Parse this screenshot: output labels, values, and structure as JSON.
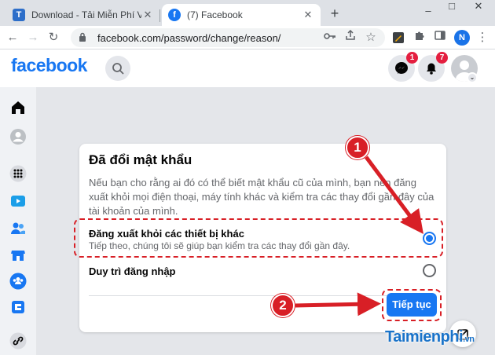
{
  "browser": {
    "tabs": [
      {
        "title": "Download - Tải Miễn Phí VN - Ph",
        "favicon": "T",
        "active": false
      },
      {
        "title": "(7) Facebook",
        "favicon": "f",
        "active": true
      }
    ],
    "new_tab": "+",
    "url": "facebook.com/password/change/reason/",
    "profile_initial": "N",
    "window_controls": [
      "–",
      "□",
      "✕"
    ]
  },
  "facebook": {
    "logo": "facebook",
    "badges": {
      "messenger": "1",
      "notifications": "7"
    },
    "accent": "#1877f2"
  },
  "card": {
    "title": "Đã đổi mật khẩu",
    "description": "Nếu bạn cho rằng ai đó có thể biết mật khẩu cũ của mình, bạn nên đăng xuất khỏi mọi điện thoại, máy tính khác và kiểm tra các thay đổi gần đây của tài khoản của mình.",
    "options": [
      {
        "label": "Đăng xuất khỏi các thiết bị khác",
        "sub": "Tiếp theo, chúng tôi sẽ giúp bạn kiểm tra các thay đổi gần đây.",
        "selected": true
      },
      {
        "label": "Duy trì đăng nhập",
        "sub": "",
        "selected": false
      }
    ],
    "continue_label": "Tiếp tục"
  },
  "annotations": {
    "step1": "1",
    "step2": "2",
    "color": "#d81f26"
  },
  "watermark": {
    "text": "Taimienphi",
    "suffix": ".vn"
  }
}
